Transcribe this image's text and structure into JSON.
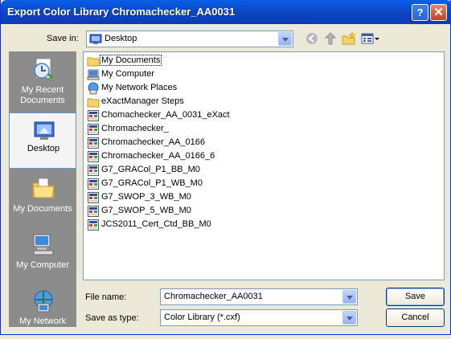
{
  "window": {
    "title": "Export Color Library Chromachecker_AA0031",
    "help_label": "?",
    "close_label": "✕"
  },
  "save_in": {
    "label": "Save in:",
    "value": "Desktop"
  },
  "places": [
    {
      "label": "My Recent Documents"
    },
    {
      "label": "Desktop"
    },
    {
      "label": "My Documents"
    },
    {
      "label": "My Computer"
    },
    {
      "label": "My Network"
    }
  ],
  "files": [
    {
      "name": "My Documents",
      "icon": "folder-icon"
    },
    {
      "name": "My Computer",
      "icon": "computer-icon"
    },
    {
      "name": "My Network Places",
      "icon": "network-icon"
    },
    {
      "name": "eXactManager Steps",
      "icon": "folder-icon"
    },
    {
      "name": "Chomachecker_AA_0031_eXact",
      "icon": "cxf-file-icon"
    },
    {
      "name": "Chromachecker_",
      "icon": "cxf-file-icon"
    },
    {
      "name": "Chromachecker_AA_0166",
      "icon": "cxf-file-icon"
    },
    {
      "name": "Chromachecker_AA_0166_6",
      "icon": "cxf-file-icon"
    },
    {
      "name": "G7_GRACol_P1_BB_M0",
      "icon": "cxf-file-icon"
    },
    {
      "name": "G7_GRACol_P1_WB_M0",
      "icon": "cxf-file-icon"
    },
    {
      "name": "G7_SWOP_3_WB_M0",
      "icon": "cxf-file-icon"
    },
    {
      "name": "G7_SWOP_5_WB_M0",
      "icon": "cxf-file-icon"
    },
    {
      "name": "JCS2011_Cert_Ctd_BB_M0",
      "icon": "cxf-file-icon"
    }
  ],
  "file_name": {
    "label": "File name:",
    "value": "Chromachecker_AA0031"
  },
  "save_as_type": {
    "label": "Save as type:",
    "value": "Color Library (*.cxf)"
  },
  "buttons": {
    "save": "Save",
    "cancel": "Cancel"
  }
}
